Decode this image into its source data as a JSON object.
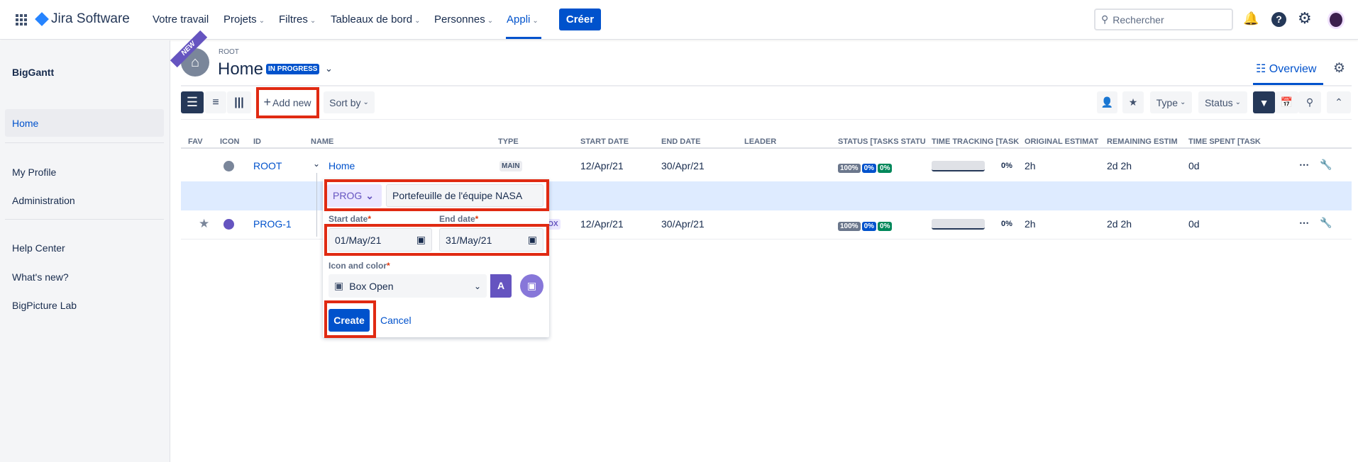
{
  "nav": {
    "app_name": "Jira Software",
    "items": [
      {
        "label": "Votre travail",
        "chevron": false
      },
      {
        "label": "Projets",
        "chevron": true
      },
      {
        "label": "Filtres",
        "chevron": true
      },
      {
        "label": "Tableaux de bord",
        "chevron": true
      },
      {
        "label": "Personnes",
        "chevron": true
      },
      {
        "label": "Appli",
        "chevron": true,
        "active": true
      }
    ],
    "create_label": "Créer",
    "search_placeholder": "Rechercher"
  },
  "sidebar": {
    "title": "BigGantt",
    "items": [
      {
        "label": "Home",
        "active": true
      },
      {
        "label": "My Profile"
      },
      {
        "label": "Administration"
      },
      {
        "label": "Help Center"
      },
      {
        "label": "What's new?"
      },
      {
        "label": "BigPicture Lab"
      }
    ]
  },
  "header": {
    "ribbon": "NEW",
    "breadcrumb": "ROOT",
    "title": "Home",
    "status": "IN PROGRESS",
    "tab_overview": "Overview"
  },
  "toolbar": {
    "add_new": "Add new",
    "sort_by": "Sort by",
    "type": "Type",
    "status": "Status"
  },
  "table": {
    "columns": [
      "FAV",
      "ICON",
      "ID",
      "NAME",
      "TYPE",
      "START DATE",
      "END DATE",
      "LEADER",
      "STATUS [TASKS STATU",
      "TIME TRACKING [TASK",
      "ORIGINAL ESTIMAT",
      "REMAINING ESTIM",
      "TIME SPENT [TASK"
    ],
    "rows": [
      {
        "id": "ROOT",
        "name": "Home",
        "type": "MAIN",
        "start": "12/Apr/21",
        "end": "30/Apr/21",
        "status": [
          "100%",
          "0%",
          "0%"
        ],
        "tracking_pct": "0%",
        "original": "2h",
        "remaining": "2d 2h",
        "spent": "0d"
      },
      {
        "id": "PROG-1",
        "name": "",
        "type": "BOX",
        "start": "12/Apr/21",
        "end": "30/Apr/21",
        "status": [
          "100%",
          "0%",
          "0%"
        ],
        "tracking_pct": "0%",
        "original": "2h",
        "remaining": "2d 2h",
        "spent": "0d"
      }
    ]
  },
  "popup": {
    "type_select": "PROG",
    "name_value": "Portefeuille de l'équipe NASA",
    "start_label": "Start date",
    "end_label": "End date",
    "required": "*",
    "start_value": "01/May/21",
    "end_value": "31/May/21",
    "icon_label": "Icon and color",
    "icon_value": "Box Open",
    "color_letter": "A",
    "create": "Create",
    "cancel": "Cancel"
  },
  "colors": {
    "brand": "#0052cc",
    "accent_purple": "#6554c0",
    "highlight": "#deebff",
    "annotation": "#e02a12"
  }
}
